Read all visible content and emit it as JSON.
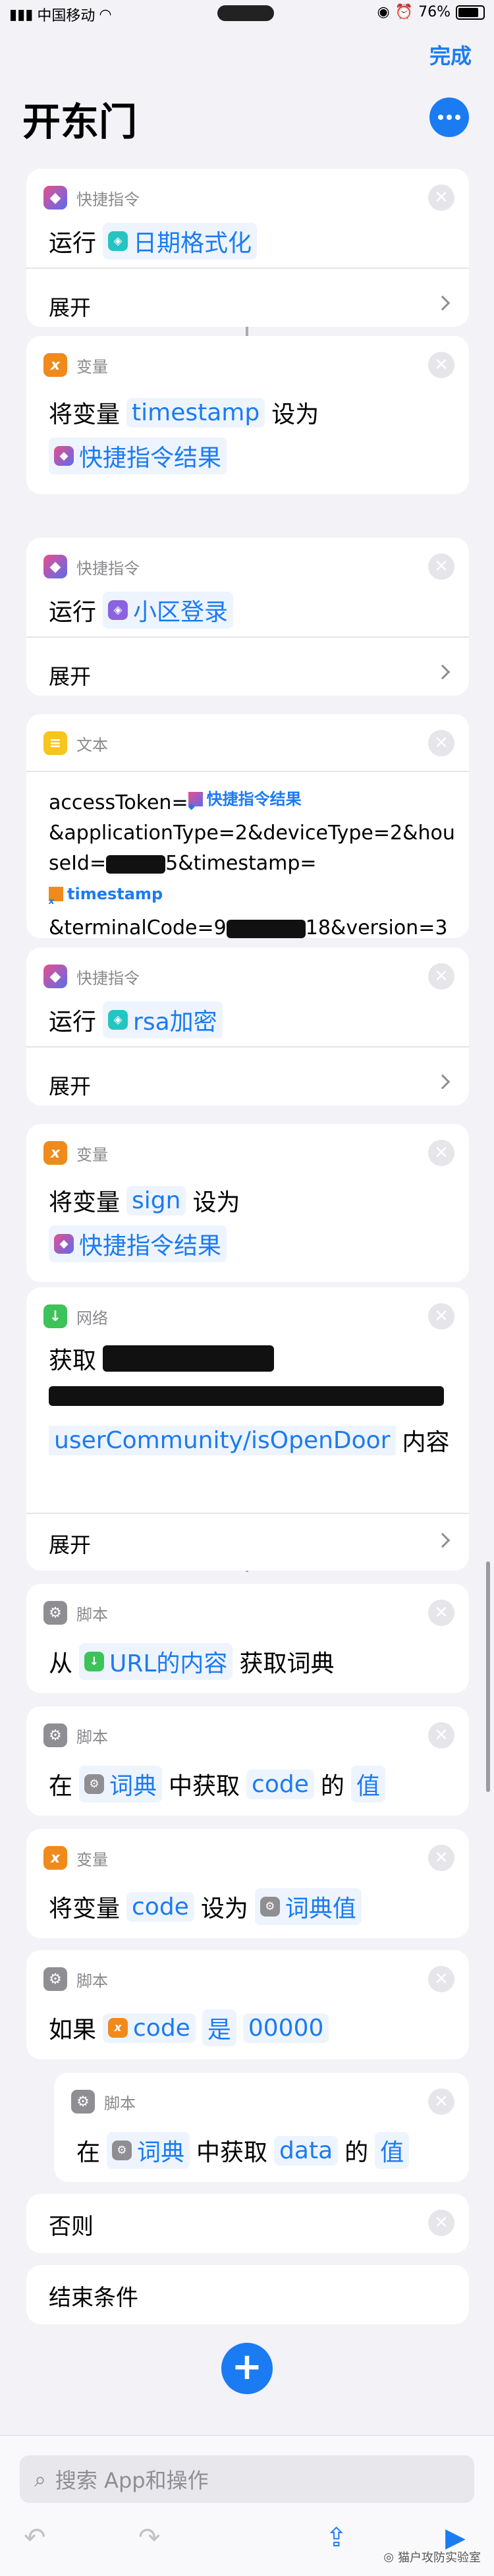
{
  "status_bar": {
    "carrier": "中国移动",
    "battery": "76%"
  },
  "nav": {
    "done_label": "完成",
    "title": "开东门"
  },
  "actions": [
    {
      "type": "快捷指令",
      "verb": "运行",
      "token": "日期格式化",
      "expand": "展开"
    },
    {
      "type": "变量",
      "prefix": "将变量",
      "var": "timestamp",
      "mid": "设为",
      "value": "快捷指令结果"
    },
    {
      "type": "快捷指令",
      "verb": "运行",
      "token": "小区登录",
      "expand": "展开"
    },
    {
      "type": "文本",
      "text_parts": [
        "accessToken=",
        "快捷指令结果",
        "&applicationType=2&deviceType=2&houseId=",
        "5&timestamp=",
        "timestamp",
        "&terminalCode=9",
        "18&version=3"
      ]
    },
    {
      "type": "快捷指令",
      "verb": "运行",
      "token": "rsa加密",
      "expand": "展开"
    },
    {
      "type": "变量",
      "prefix": "将变量",
      "var": "sign",
      "mid": "设为",
      "value": "快捷指令结果"
    },
    {
      "type": "网络",
      "verb": "获取",
      "url_end": "userCommunity/isOpenDoor",
      "suffix": "内容",
      "expand": "展开"
    },
    {
      "type": "脚本",
      "from": "从",
      "token": "URL的内容",
      "tail": "获取词典"
    },
    {
      "type": "脚本",
      "at": "在",
      "token": "词典",
      "mid": "中获取",
      "key": "code",
      "of": "的",
      "val": "值"
    },
    {
      "type": "变量",
      "prefix": "将变量",
      "var": "code",
      "mid": "设为",
      "value": "词典值"
    },
    {
      "type": "脚本",
      "if": "如果",
      "var": "code",
      "op": "是",
      "cmp": "00000"
    },
    {
      "type": "脚本",
      "at": "在",
      "token": "词典",
      "mid": "中获取",
      "key": "data",
      "of": "的",
      "val": "值"
    }
  ],
  "else_label": "否则",
  "end_label": "结束条件",
  "search": {
    "placeholder": "搜索 App和操作"
  },
  "watermark": "猫户攻防实验室",
  "icons": {
    "shortcut": "shortcuts-icon",
    "variable": "variable-icon",
    "text": "text-icon",
    "network": "download-icon",
    "script": "gear-icon"
  }
}
